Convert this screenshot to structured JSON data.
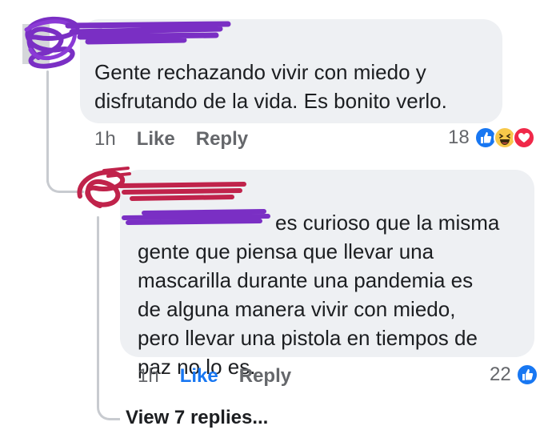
{
  "comments": [
    {
      "text": "Gente rechazando vivir con miedo y\ndisfrutando de la vida. Es bonito verlo.",
      "time": "1h",
      "like_label": "Like",
      "reply_label": "Reply",
      "reaction_count": "18",
      "reaction_icons": [
        "like-icon",
        "haha-icon",
        "love-icon"
      ]
    },
    {
      "text": "es curioso que la misma\ngente que piensa que llevar una\nmascarilla durante una pandemia es\nde alguna manera vivir con miedo,\npero llevar una pistola en tiempos de\npaz no lo es.",
      "time": "1h",
      "like_label": "Like",
      "liked": true,
      "reply_label": "Reply",
      "reaction_count": "22",
      "reaction_icons": [
        "like-icon"
      ]
    }
  ],
  "view_replies": "View 7 replies...",
  "colors": {
    "bubble": "#eef0f3",
    "text": "#1c1e21",
    "secondary": "#65676b",
    "like_blue": "#1877f2",
    "redaction_purple": "#7a2fc4",
    "redaction_red": "#c0234b"
  }
}
